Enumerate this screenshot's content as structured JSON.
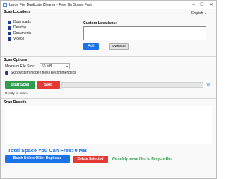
{
  "window": {
    "title": "Large File Duplicate Cleaner - Free Up Space Fast",
    "minimize": "–",
    "maximize": "☐",
    "close": "✕"
  },
  "scan_locations": {
    "heading": "Scan Locations",
    "language": "English",
    "items": [
      {
        "label": "Downloads",
        "checked": true
      },
      {
        "label": "Desktop",
        "checked": true
      },
      {
        "label": "Documents",
        "checked": true
      },
      {
        "label": "Videos",
        "checked": true
      }
    ],
    "custom_heading": "Custom Locations:",
    "add_label": "Add",
    "remove_label": "Remove"
  },
  "scan_options": {
    "heading": "Scan Options",
    "min_size_label": "Minimum File Size:",
    "min_size_value": "50 MB",
    "skip_label": "Skip system  hidden files (Recommended)",
    "skip_checked": true
  },
  "scan_controls": {
    "start_label": "Start Scan",
    "stop_label": "Stop",
    "progress_percent": 0,
    "progress_text": "0%",
    "status": "Ready to scan."
  },
  "scan_results": {
    "heading": "Scan Results"
  },
  "footer": {
    "total": "Total Space You Can Free: 0 MB",
    "batch_label": "Batch Delete Older Duplicate",
    "delete_label": "Delete Selected",
    "note": "We safely move files to Recycle Bin."
  },
  "colors": {
    "accent": "#1a73e8",
    "success": "#2e9d4e",
    "danger": "#e53935"
  }
}
